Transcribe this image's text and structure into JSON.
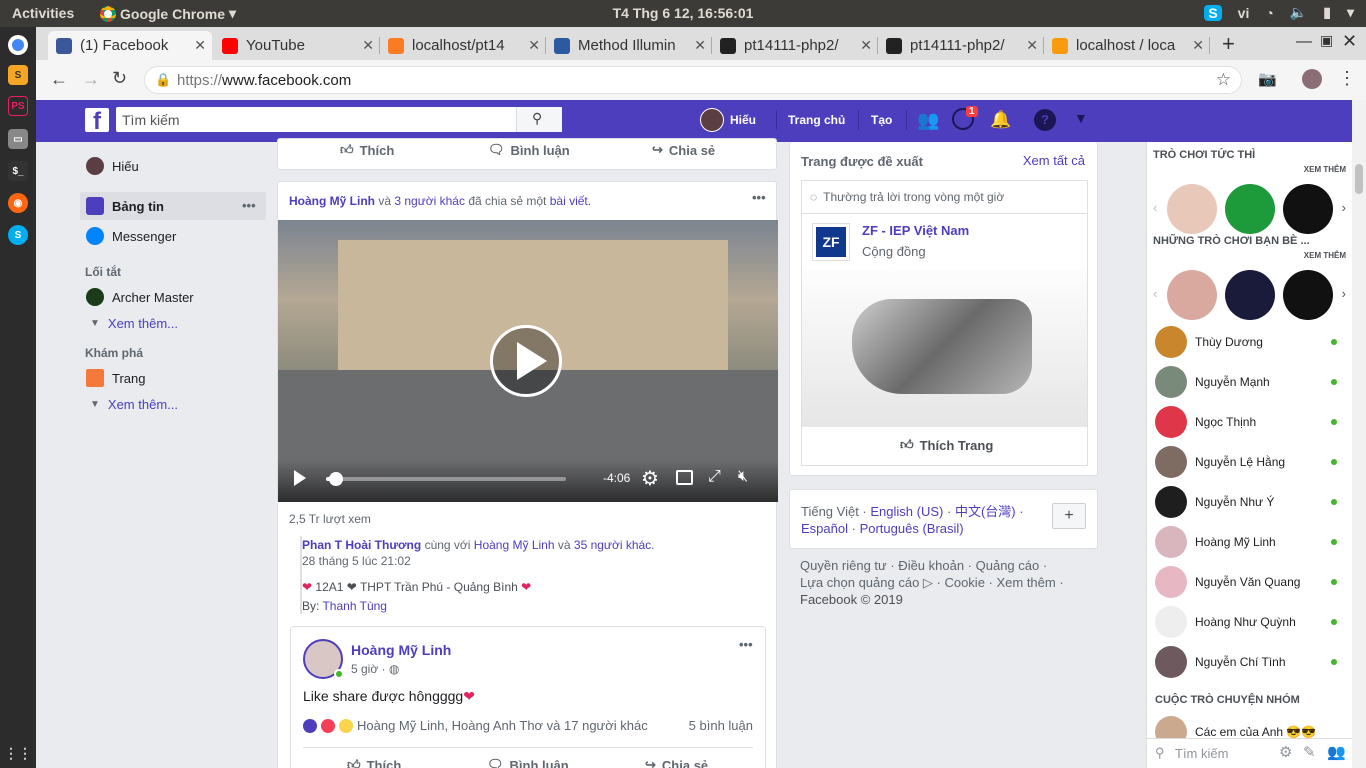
{
  "os": {
    "activities": "Activities",
    "app_name": "Google Chrome",
    "clock": "T4 Thg 6 12, 16:56:01",
    "lang": "vi"
  },
  "chrome": {
    "tabs": [
      {
        "title": "(1) Facebook",
        "icon": "facebook-icon",
        "color": "#3b5998"
      },
      {
        "title": "YouTube",
        "icon": "youtube-icon",
        "color": "#ff0000"
      },
      {
        "title": "localhost/pt14",
        "icon": "xampp-icon",
        "color": "#fb7a24"
      },
      {
        "title": "Method Illumin",
        "icon": "laravel-api-icon",
        "color": "#2c5aa0"
      },
      {
        "title": "pt14111-php2/",
        "icon": "github-icon",
        "color": "#222222"
      },
      {
        "title": "pt14111-php2/",
        "icon": "github-icon",
        "color": "#222222"
      },
      {
        "title": "localhost / loca",
        "icon": "phpmyadmin-icon",
        "color": "#f89c0e"
      }
    ],
    "url_scheme": "https://",
    "url_host": "www.facebook.com"
  },
  "fb": {
    "search_placeholder": "Tìm kiếm",
    "user": "Hiếu",
    "nav_home": "Trang chủ",
    "nav_create": "Tạo",
    "messenger_badge": "1",
    "accent": "#4d3ebd"
  },
  "left": {
    "profile": "Hiếu",
    "newsfeed": "Bảng tin",
    "messenger": "Messenger",
    "shortcuts_head": "Lối tắt",
    "shortcut_1": "Archer Master",
    "see_more": "Xem thêm...",
    "explore_head": "Khám phá",
    "pages": "Trang",
    "see_more_2": "Xem thêm..."
  },
  "feed": {
    "top_like": "Thích",
    "top_comment": "Bình luận",
    "top_share": "Chia sẻ",
    "post_actor": "Hoàng Mỹ Linh",
    "post_and": "và",
    "post_others": "3 người khác",
    "post_verb": "đã chia sẻ một",
    "post_obj": "bài viết",
    "video_time": "-4:06",
    "video_progress": 0.02,
    "views": "2,5 Tr lượt xem",
    "orig_author": "Phan T Hoài Thương",
    "orig_with": "cùng với",
    "orig_tag": "Hoàng Mỹ Linh",
    "orig_and": "và",
    "orig_others": "35 người khác",
    "orig_date": "28 tháng 5 lúc 21:02",
    "orig_text": "12A1 ❤ THPT Trần Phú - Quảng Bình",
    "orig_by": "By:",
    "orig_by_name": "Thanh Tùng",
    "share_author": "Hoàng Mỹ Linh",
    "share_time": "5 giờ ·",
    "share_text": "Like share được hôngggg",
    "reactions": "Hoàng Mỹ Linh, Hoàng Anh Thơ và 17 người khác",
    "comments_count": "5 bình luận",
    "like": "Thích",
    "comment": "Bình luận",
    "share": "Chia sẻ"
  },
  "right": {
    "suggested_head": "Trang được đề xuất",
    "see_all": "Xem tất cả",
    "response": "Thường trả lời trong vòng một giờ",
    "page_name": "ZF - IEP Việt Nam",
    "page_cat": "Cộng đồng",
    "like_page": "Thích Trang",
    "lang_current": "Tiếng Việt ·",
    "lang_en": "English (US)",
    "lang_zh": "中文(台灣)",
    "lang_es": "Español",
    "lang_pt": "Português (Brasil)",
    "footer_1": "Quyền riêng tư · Điều khoản · Quảng cáo ·",
    "footer_2": "Lựa chọn quảng cáo ▷ · Cookie · Xem thêm ·",
    "footer_3": "Facebook © 2019"
  },
  "chat": {
    "instant_games": "TRÒ CHƠI TỨC THÌ",
    "see_more": "XEM THÊM",
    "friends_games": "NHỮNG TRÒ CHƠI BẠN BÈ ...",
    "see_more_2": "XEM THÊM",
    "friends": [
      "Thùy Dương",
      "Nguyễn Mạnh",
      "Ngọc Thịnh",
      "Nguyễn Lệ Hằng",
      "Nguyễn Như Ý",
      "Hoàng Mỹ Linh",
      "Nguyễn Văn Quang",
      "Hoàng Như Quỳnh",
      "Nguyễn Chí Tình"
    ],
    "group_head": "CUỘC TRÒ CHUYỆN NHÓM",
    "group_1": "Các em của Anh 😎😎",
    "search_placeholder": "Tìm kiếm"
  }
}
